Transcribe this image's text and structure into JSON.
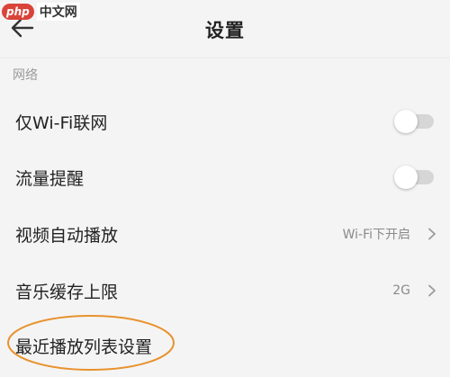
{
  "logo": {
    "php": "php",
    "cn": "中文网"
  },
  "header": {
    "title": "设置"
  },
  "section": {
    "title": "网络"
  },
  "rows": [
    {
      "label": "仅Wi-Fi联网",
      "type": "toggle",
      "on": false
    },
    {
      "label": "流量提醒",
      "type": "toggle",
      "on": false
    },
    {
      "label": "视频自动播放",
      "type": "value",
      "value": "Wi-Fi下开启"
    },
    {
      "label": "音乐缓存上限",
      "type": "value",
      "value": "2G"
    },
    {
      "label": "最近播放列表设置",
      "type": "link",
      "highlighted": true
    }
  ],
  "colors": {
    "background": "#f4f4f4",
    "highlight": "#e8922e",
    "toggle_track": "#d6d6d6",
    "secondary_text": "#8a8a8a"
  }
}
